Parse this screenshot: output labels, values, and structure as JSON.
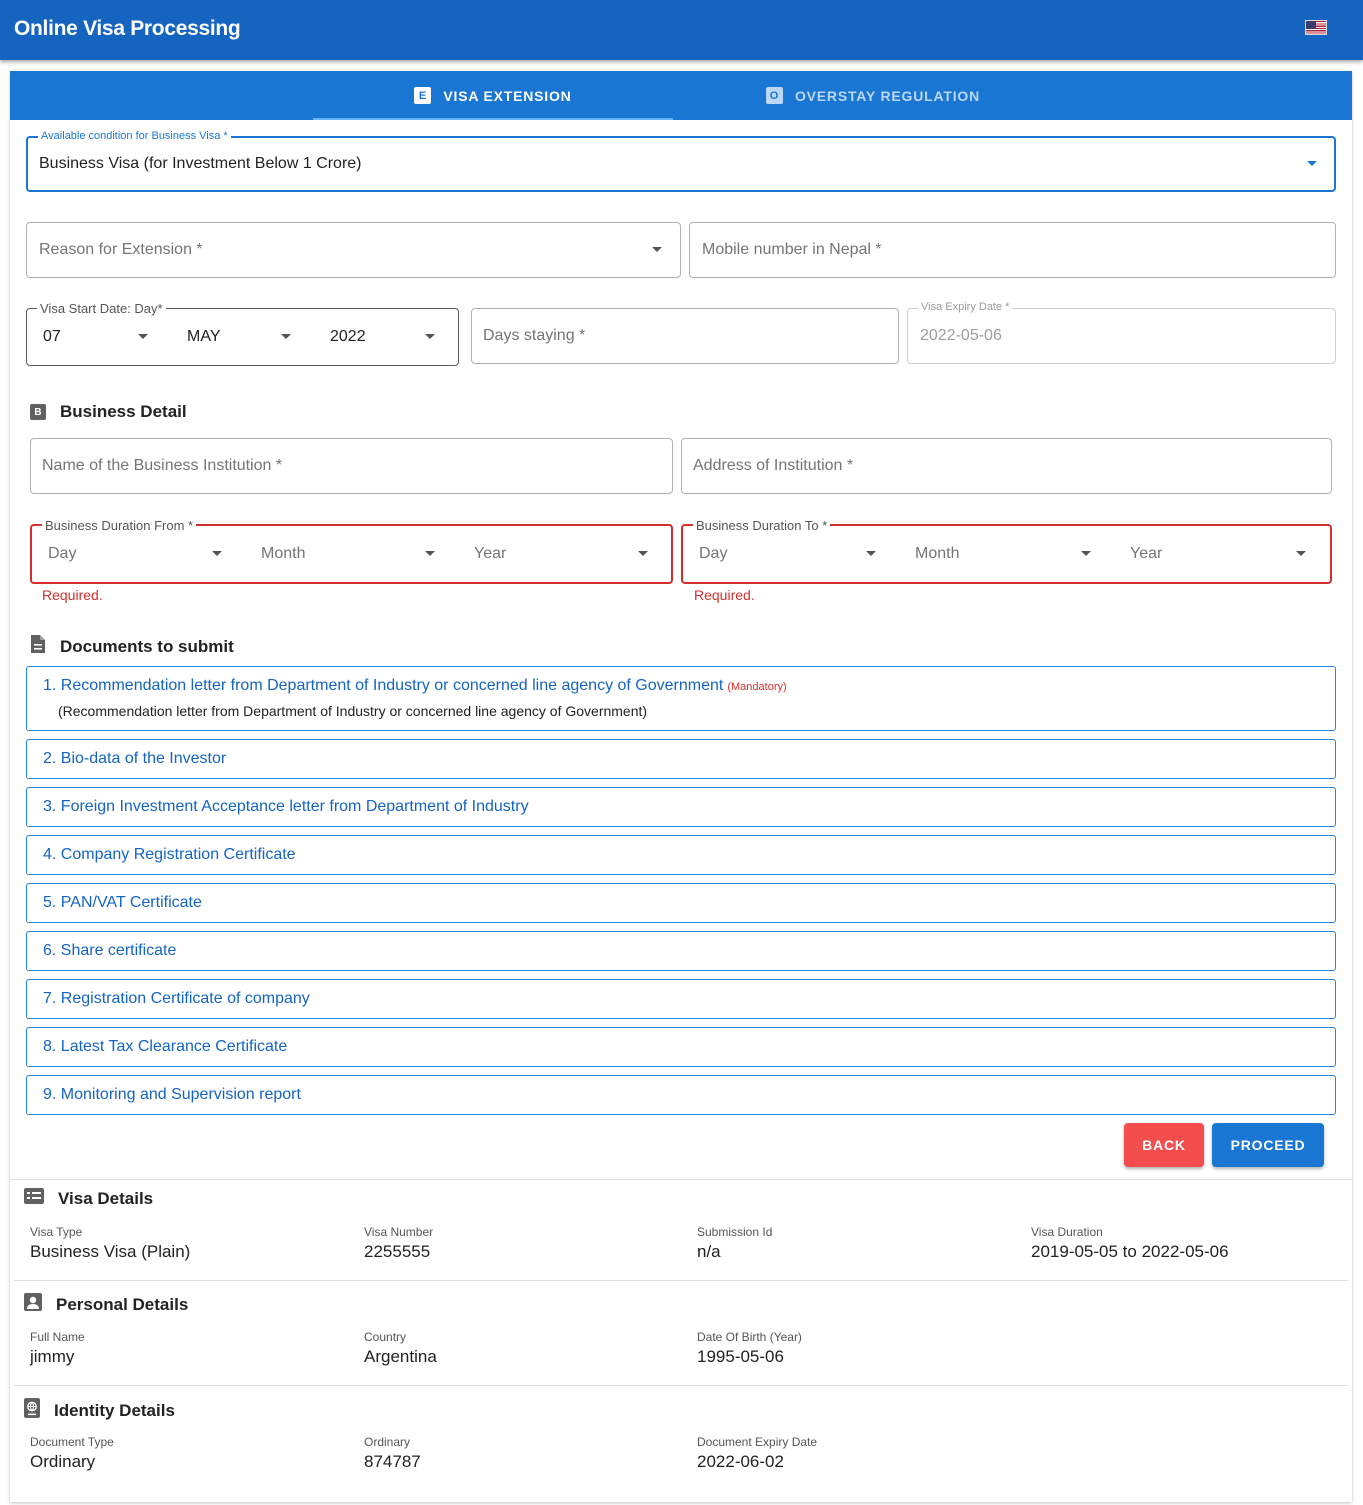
{
  "app": {
    "title": "Online Visa Processing",
    "language_flag": "us-flag-icon"
  },
  "tabs": [
    {
      "badge": "E",
      "label": "VISA EXTENSION",
      "active": true
    },
    {
      "badge": "O",
      "label": "OVERSTAY REGULATION",
      "active": false
    }
  ],
  "form": {
    "condition": {
      "label": "Available condition for Business Visa *",
      "value": "Business Visa (for Investment Below 1 Crore)"
    },
    "reason": {
      "placeholder": "Reason for Extension *"
    },
    "mobile": {
      "placeholder": "Mobile number in Nepal *"
    },
    "start_date": {
      "label": "Visa Start Date: Day*",
      "day": "07",
      "month": "MAY",
      "year": "2022"
    },
    "days_staying": {
      "placeholder": "Days staying *"
    },
    "expiry": {
      "label": "Visa Expiry Date *",
      "value": "2022-05-06"
    }
  },
  "business": {
    "badge": "B",
    "title": "Business Detail",
    "name_placeholder": "Name of the Business Institution *",
    "address_placeholder": "Address of Institution *",
    "from": {
      "label": "Business Duration From *",
      "day": "Day",
      "month": "Month",
      "year": "Year",
      "error": "Required."
    },
    "to": {
      "label": "Business Duration To *",
      "day": "Day",
      "month": "Month",
      "year": "Year",
      "error": "Required."
    }
  },
  "documents": {
    "title": "Documents to submit",
    "items": [
      {
        "title": "1. Recommendation letter from Department of Industry or concerned line agency of Government",
        "mandatory": "(Mandatory)",
        "description": "(Recommendation letter from Department of Industry or concerned line agency of Government)"
      },
      {
        "title": "2. Bio-data of the Investor"
      },
      {
        "title": "3. Foreign Investment Acceptance letter from Department of Industry"
      },
      {
        "title": "4. Company Registration Certificate"
      },
      {
        "title": "5. PAN/VAT Certificate"
      },
      {
        "title": "6. Share certificate"
      },
      {
        "title": "7. Registration Certificate of company"
      },
      {
        "title": "8. Latest Tax Clearance Certificate"
      },
      {
        "title": "9. Monitoring and Supervision report"
      }
    ]
  },
  "buttons": {
    "back": "BACK",
    "proceed": "PROCEED"
  },
  "visa_details": {
    "title": "Visa Details",
    "fields": [
      {
        "label": "Visa Type",
        "value": "Business Visa (Plain)"
      },
      {
        "label": "Visa Number",
        "value": "2255555"
      },
      {
        "label": "Submission Id",
        "value": "n/a"
      },
      {
        "label": "Visa Duration",
        "value": "2019-05-05 to 2022-05-06"
      }
    ]
  },
  "personal_details": {
    "title": "Personal Details",
    "fields": [
      {
        "label": "Full Name",
        "value": "jimmy"
      },
      {
        "label": "Country",
        "value": "Argentina"
      },
      {
        "label": "Date Of Birth (Year)",
        "value": "1995-05-06"
      }
    ]
  },
  "identity_details": {
    "title": "Identity Details",
    "fields": [
      {
        "label": "Document Type",
        "value": "Ordinary"
      },
      {
        "label": "Ordinary",
        "value": "874787"
      },
      {
        "label": "Document Expiry Date",
        "value": "2022-06-02"
      }
    ]
  },
  "colors": {
    "primary": "#1976d2",
    "appbar": "#1565c0",
    "error": "#d32f2f",
    "back_button": "#f44d4d"
  }
}
